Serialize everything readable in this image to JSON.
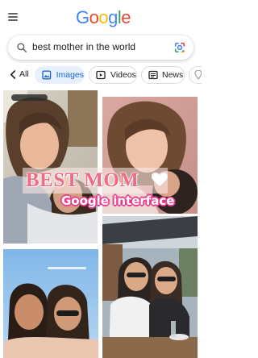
{
  "header": {
    "menu_icon": "hamburger-menu-icon",
    "logo": [
      "G",
      "o",
      "o",
      "g",
      "l",
      "e"
    ],
    "logo_colors": [
      "#4285f4",
      "#ea4335",
      "#fbbc05",
      "#4285f4",
      "#34a853",
      "#ea4335"
    ]
  },
  "search": {
    "query": "best mother in the world",
    "search_icon": "search-icon",
    "lens_icon": "google-lens-icon"
  },
  "tabs": {
    "back_label": "All",
    "items": [
      {
        "label": "Images",
        "icon": "image-icon",
        "active": true
      },
      {
        "label": "Videos",
        "icon": "video-play-icon",
        "active": false
      },
      {
        "label": "News",
        "icon": "newspaper-icon",
        "active": false
      }
    ]
  },
  "overlay": {
    "title": "BEST MOM",
    "heart": "white-heart-icon",
    "subtitle": "Google interface"
  },
  "colors": {
    "accent": "#1967d2",
    "active_tab_bg": "#e8f0fe",
    "overlay_pink": "#f06b86",
    "subtitle_outline": "#e83f8e"
  }
}
